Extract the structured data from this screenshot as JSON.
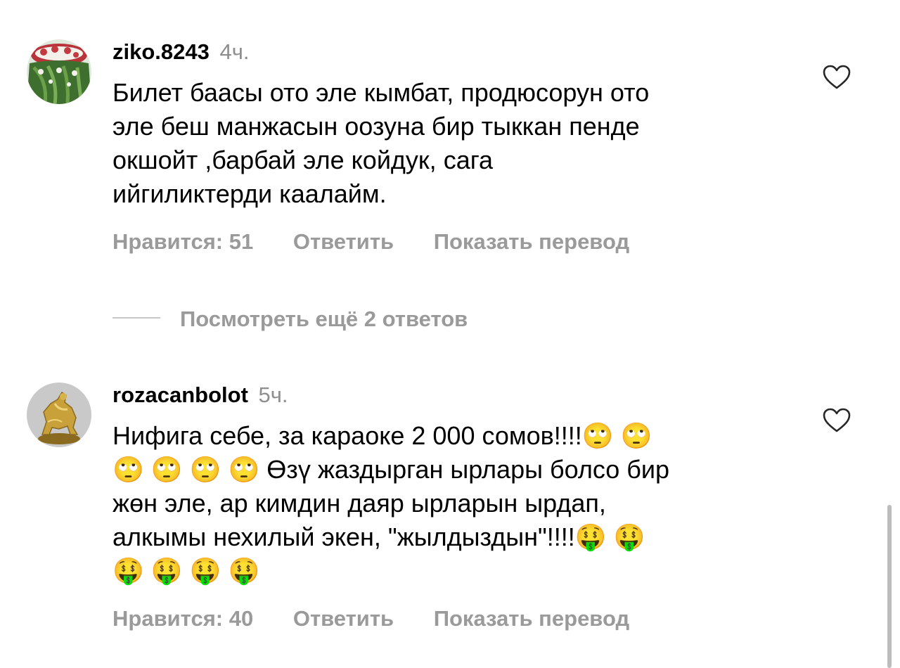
{
  "comments": [
    {
      "username": "ziko.8243",
      "time": "4ч.",
      "text_lines": [
        "Билет баасы ото эле кымбат, продюсорун ото",
        "эле беш манжасын оозуна бир тыккан пенде",
        "окшойт ,барбай эле койдук, сага",
        "ийгиликтерди каалайм."
      ],
      "likes_label": "Нравится: 51",
      "reply_label": "Ответить",
      "translate_label": "Показать перевод",
      "avatar_icon": "roses-bouquet-avatar",
      "like_icon": "heart-outline-icon"
    },
    {
      "username": "rozacanbolot",
      "time": "5ч.",
      "text_lines": [
        "Нифига себе, за караоке 2 000 сомов!!!!🙄 🙄",
        "🙄 🙄 🙄 🙄  Өзү жаздырган ырлары болсо бир",
        "жөн эле, ар кимдин даяр ырларын ырдап,",
        "алкымы нехилый экен, \"жылдыздын\"!!!!🤑 🤑",
        "🤑 🤑 🤑 🤑"
      ],
      "likes_label": "Нравится: 40",
      "reply_label": "Ответить",
      "translate_label": "Показать перевод",
      "avatar_icon": "golden-horse-statue-avatar",
      "like_icon": "heart-outline-icon"
    }
  ],
  "view_replies_label": "Посмотреть ещё 2 ответов",
  "colors": {
    "secondary_text": "#9a9a9a",
    "time_text": "#8e8e8e",
    "divider": "#c7c7c7"
  }
}
